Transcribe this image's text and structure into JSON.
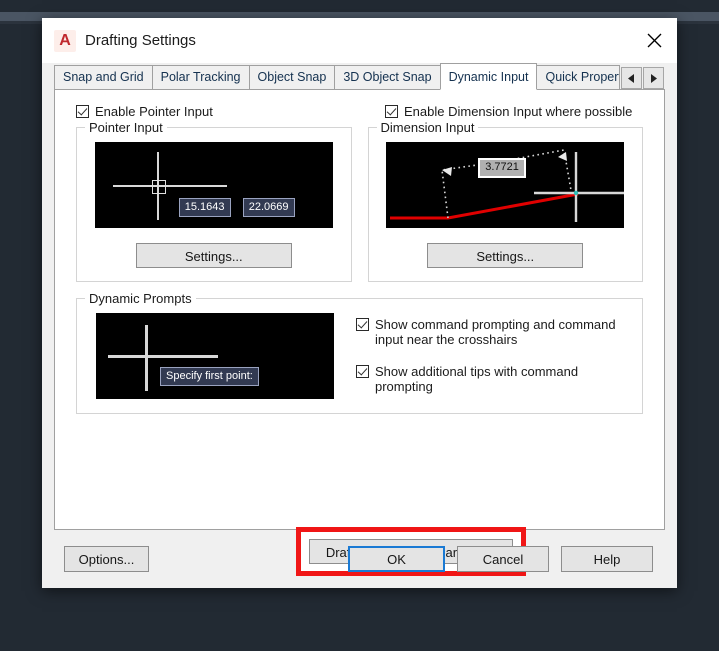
{
  "window": {
    "title": "Drafting Settings",
    "logo_letter": "A",
    "close_icon": "close-icon"
  },
  "tabs": [
    {
      "label": "Snap and Grid",
      "active": false
    },
    {
      "label": "Polar Tracking",
      "active": false
    },
    {
      "label": "Object Snap",
      "active": false
    },
    {
      "label": "3D Object Snap",
      "active": false
    },
    {
      "label": "Dynamic Input",
      "active": true
    },
    {
      "label": "Quick Propert",
      "active": false
    }
  ],
  "tab_scroll": {
    "left_arrow": "◄",
    "right_arrow": "►"
  },
  "enable_checkboxes": {
    "pointer_input": {
      "label": "Enable Pointer Input",
      "checked": true
    },
    "dimension_input": {
      "label": "Enable Dimension Input where possible",
      "checked": true
    }
  },
  "pointer_input_group": {
    "title": "Pointer Input",
    "settings_button": "Settings...",
    "preview": {
      "tooltip_x": "15.1643",
      "tooltip_y": "22.0669"
    }
  },
  "dimension_input_group": {
    "title": "Dimension Input",
    "settings_button": "Settings...",
    "preview": {
      "dimension_value": "3.7721",
      "geometry_color": "#e00000"
    }
  },
  "dynamic_prompts_group": {
    "title": "Dynamic Prompts",
    "preview": {
      "prompt_text": "Specify first point:"
    },
    "checkboxes": [
      {
        "label": "Show command prompting and command input near the crosshairs",
        "checked": true
      },
      {
        "label": "Show additional tips with command prompting",
        "checked": true
      }
    ]
  },
  "tooltip_appearance": {
    "button_label": "Drafting Tooltip Appearance...",
    "highlight_color": "#f01616"
  },
  "footer": {
    "options": "Options...",
    "ok": "OK",
    "cancel": "Cancel",
    "help": "Help",
    "focus_color": "#1a7ad4"
  }
}
